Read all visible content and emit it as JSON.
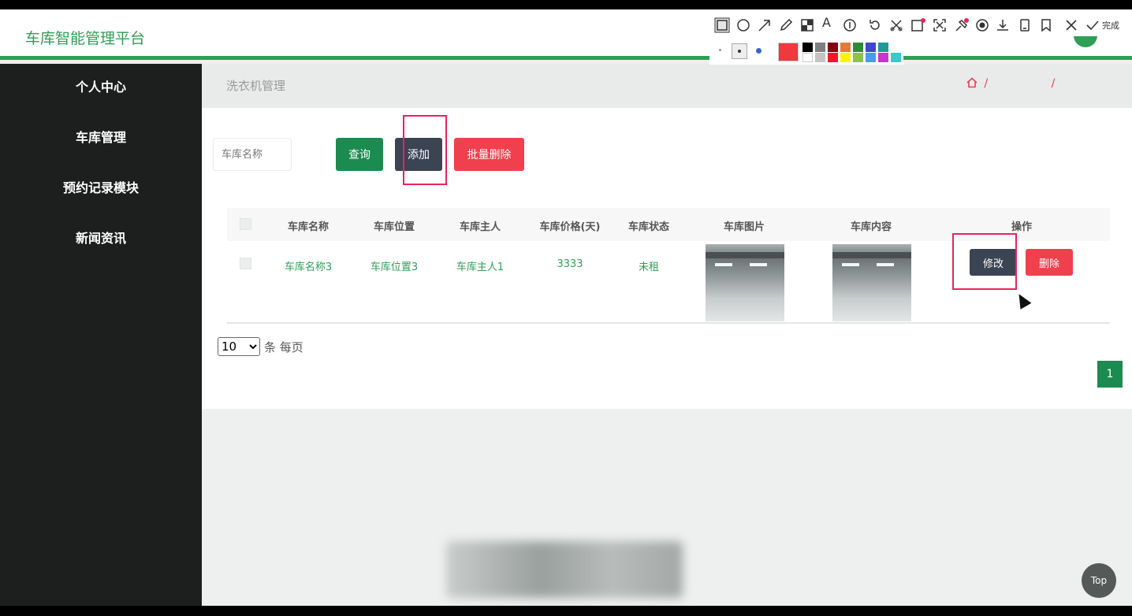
{
  "app": {
    "title": "车库智能管理平台"
  },
  "sidebar": {
    "items": [
      {
        "label": "个人中心"
      },
      {
        "label": "车库管理"
      },
      {
        "label": "预约记录模块"
      },
      {
        "label": "新闻资讯"
      }
    ]
  },
  "breadcrumb": {
    "title": "洗衣机管理",
    "separator": "/  /"
  },
  "search": {
    "placeholder": "车库名称"
  },
  "actions": {
    "query": "查询",
    "add": "添加",
    "batch_delete": "批量删除"
  },
  "table": {
    "headers": [
      "车库名称",
      "车库位置",
      "车库主人",
      "车库价格(天)",
      "车库状态",
      "车库图片",
      "车库内容",
      "操作"
    ],
    "rows": [
      {
        "name": "车库名称3",
        "location": "车库位置3",
        "owner": "车库主人1",
        "price": "3333",
        "status": "未租"
      }
    ],
    "row_actions": {
      "edit": "修改",
      "delete": "删除"
    }
  },
  "pagination": {
    "page_size": "10",
    "page_size_label": "条 每页",
    "current_page": "1"
  },
  "top_button": "Top",
  "screenshot_toolbar": {
    "done_label": "完成"
  },
  "colors": {
    "brand_green": "#2e9f56",
    "dark_button": "#3b4452",
    "danger": "#f0404d",
    "annotation": "#e8245b"
  },
  "icons": [
    "home-icon",
    "rectangle-icon",
    "circle-icon",
    "arrow-icon",
    "pen-icon",
    "mosaic-icon",
    "text-icon",
    "number-icon",
    "undo-icon",
    "crop-icon",
    "ocr-icon",
    "scan-icon",
    "pin-icon",
    "record-icon",
    "download-icon",
    "save-icon",
    "bookmark-icon",
    "close-icon",
    "check-icon"
  ]
}
